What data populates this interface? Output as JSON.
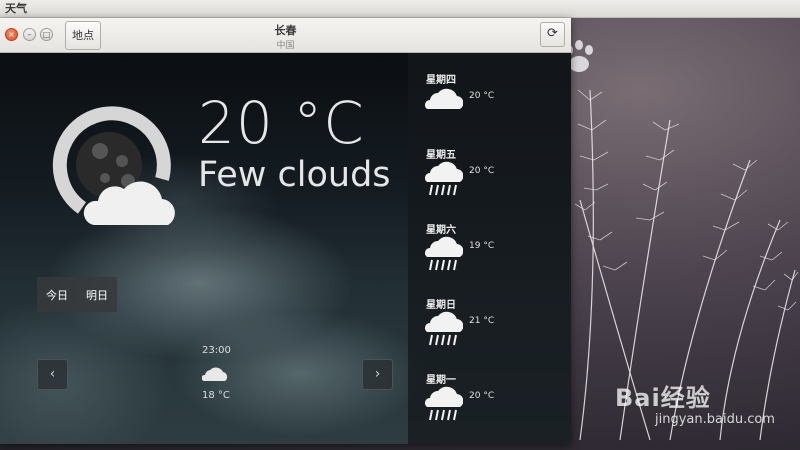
{
  "top_panel": {
    "app_name": "天气"
  },
  "titlebar": {
    "places_label": "地点",
    "city": "长春",
    "country": "中国",
    "refresh_icon": "refresh-icon"
  },
  "current": {
    "temperature": "20 °C",
    "condition": "Few clouds",
    "icon": "few-clouds-night-icon"
  },
  "day_tabs": [
    "今日",
    "明日"
  ],
  "hourly": {
    "time": "23:00",
    "temperature": "18 °C",
    "icon": "cloud-icon"
  },
  "forecast": [
    {
      "day": "星期四",
      "temperature": "20 °C",
      "icon": "cloud-icon"
    },
    {
      "day": "星期五",
      "temperature": "20 °C",
      "icon": "rain-icon"
    },
    {
      "day": "星期六",
      "temperature": "19 °C",
      "icon": "rain-icon"
    },
    {
      "day": "星期日",
      "temperature": "21 °C",
      "icon": "rain-icon"
    },
    {
      "day": "星期一",
      "temperature": "20 °C",
      "icon": "rain-icon"
    }
  ],
  "watermark": {
    "brand": "Bai经验",
    "url": "jingyan.baidu.com"
  },
  "colors": {
    "panel": "#dcdad5",
    "close_button": "#e0502a",
    "sky_dark": "#0b0e12"
  }
}
